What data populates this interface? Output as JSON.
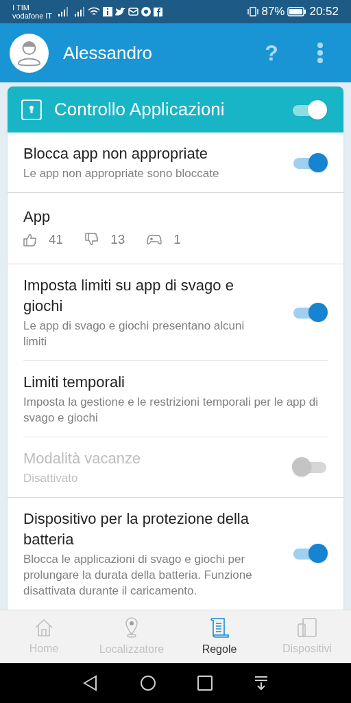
{
  "status_bar": {
    "carrier_1": "I TIM",
    "carrier_2": "vodafone IT",
    "battery": "87%",
    "time": "20:52"
  },
  "header": {
    "name": "Alessandro",
    "help": "?"
  },
  "card": {
    "title": "Controllo Applicazioni",
    "on": true,
    "sections": [
      {
        "items": [
          {
            "kind": "toggle",
            "title": "Blocca app non appropriate",
            "subtitle": "Le app non appropriate sono bloccate",
            "on": true,
            "disabled": false
          }
        ]
      },
      {
        "items": [
          {
            "kind": "stats",
            "title": "App",
            "allowed": "41",
            "blocked": "13",
            "games": "1"
          }
        ]
      },
      {
        "items": [
          {
            "kind": "toggle",
            "title": "Imposta limiti su app di svago e giochi",
            "subtitle": "Le app di svago e giochi presentano alcuni limiti",
            "on": true,
            "disabled": false
          },
          {
            "kind": "link",
            "title": "Limiti temporali",
            "subtitle": "Imposta la gestione e le restrizioni temporali per le app di svago e giochi"
          },
          {
            "kind": "toggle",
            "title": "Modalità vacanze",
            "subtitle": "Disattivato",
            "on": false,
            "disabled": true
          }
        ]
      },
      {
        "items": [
          {
            "kind": "toggle",
            "title": "Dispositivo per la protezione della batteria",
            "subtitle": "Blocca le applicazioni di svago e giochi per prolungare la durata della batteria. Funzione disattivata durante il caricamento.",
            "on": true,
            "disabled": false
          }
        ]
      }
    ]
  },
  "tabs": [
    {
      "label": "Home",
      "kind": "home",
      "selected": false
    },
    {
      "label": "Localizzatore",
      "kind": "pin",
      "selected": false
    },
    {
      "label": "Regole",
      "kind": "scroll",
      "selected": true
    },
    {
      "label": "Dispositivi",
      "kind": "devices",
      "selected": false
    }
  ]
}
